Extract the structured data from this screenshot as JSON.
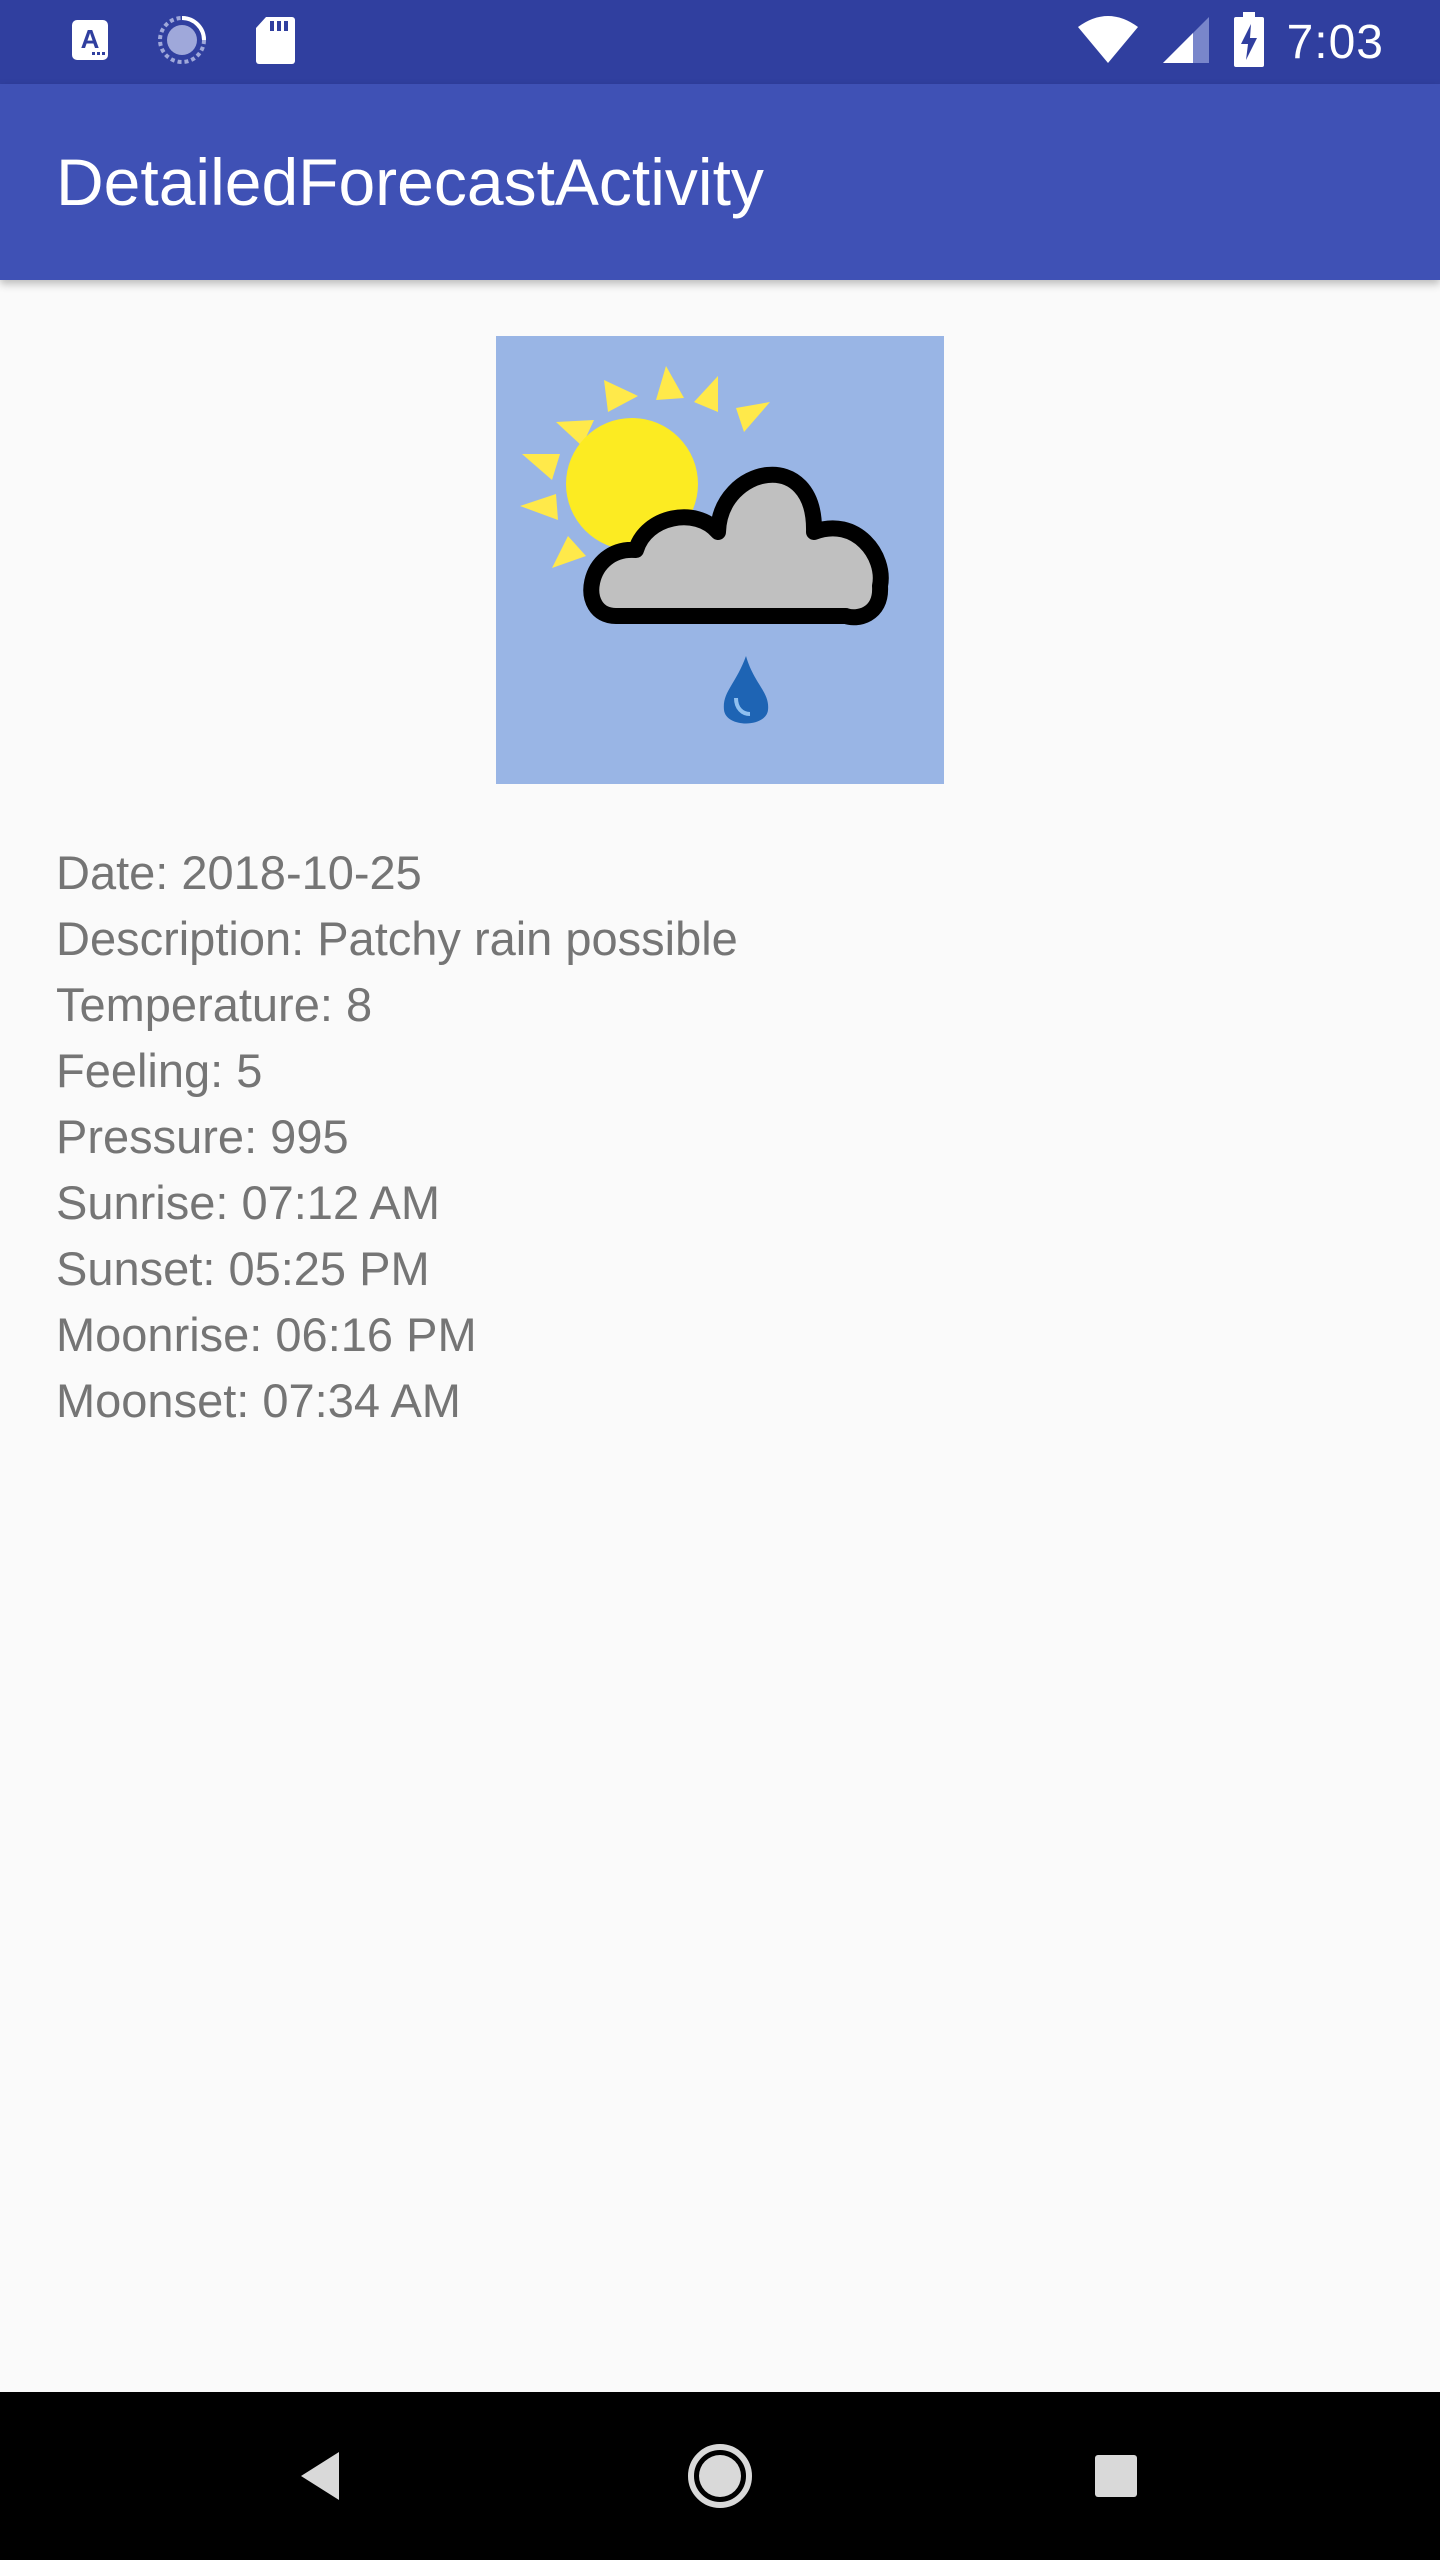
{
  "status_bar": {
    "icons_left": [
      "a-notification-icon",
      "sync-progress-icon",
      "sd-card-icon"
    ],
    "icons_right": [
      "wifi-icon",
      "cell-signal-icon",
      "battery-charging-icon"
    ],
    "time": "7:03"
  },
  "app_bar": {
    "title": "DetailedForecastActivity"
  },
  "forecast": {
    "icon": "sun-cloud-rain-icon",
    "date": "Date: 2018-10-25",
    "description": "Description: Patchy rain possible",
    "temperature": "Temperature: 8",
    "feeling": "Feeling: 5",
    "pressure": "Pressure: 995",
    "sunrise": "Sunrise: 07:12 AM",
    "sunset": "Sunset: 05:25 PM",
    "moonrise": "Moonrise: 06:16 PM",
    "moonset": "Moonset: 07:34 AM"
  },
  "nav_bar": {
    "icons": [
      "back-icon",
      "home-icon",
      "recents-icon"
    ]
  },
  "colors": {
    "status_bar": "#303F9F",
    "app_bar": "#3F51B5",
    "background": "#FAFAFA",
    "text": "#757575",
    "image_background": "#99B5E5"
  }
}
